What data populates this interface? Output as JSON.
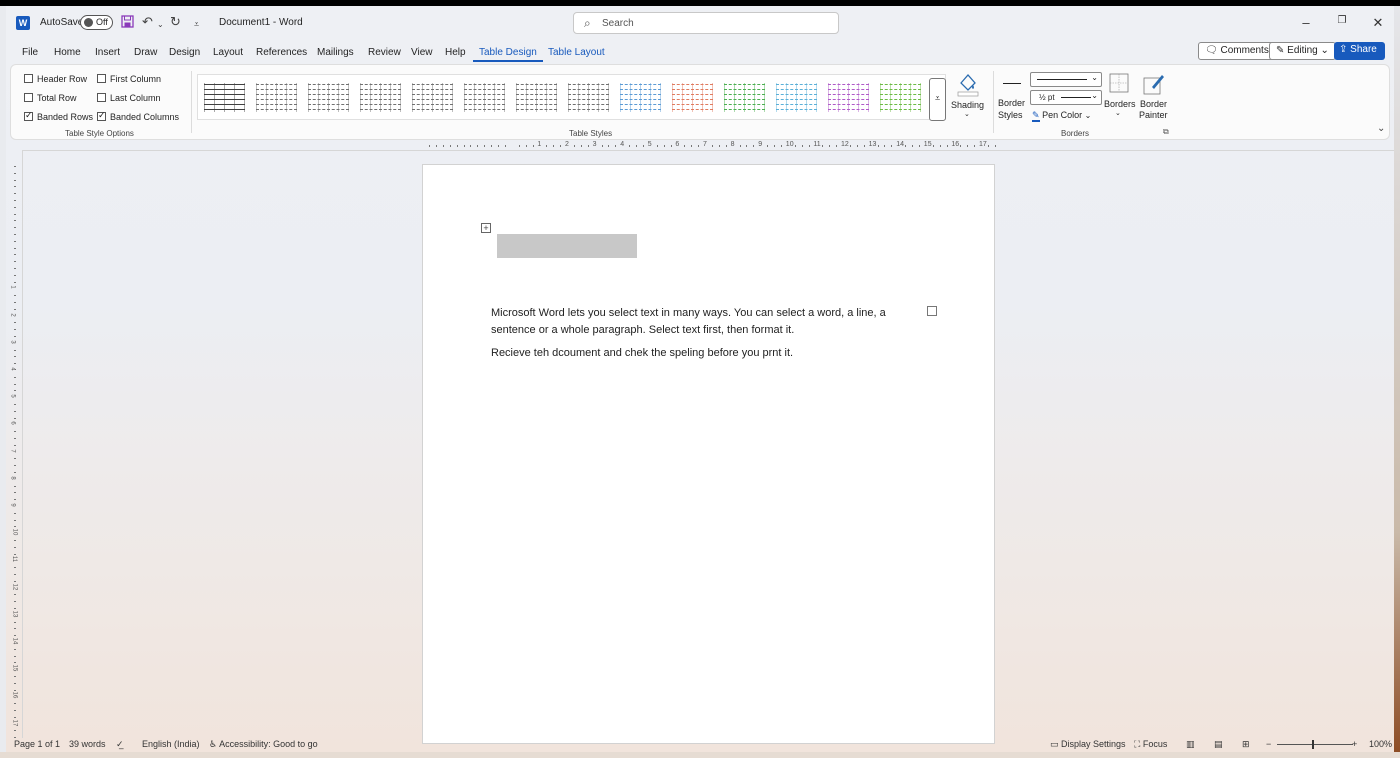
{
  "titlebar": {
    "autosave_label": "AutoSave",
    "autosave_state": "Off",
    "doc_title": "Document1  -  Word",
    "search_placeholder": "Search"
  },
  "tabs": [
    "File",
    "Home",
    "Insert",
    "Draw",
    "Design",
    "Layout",
    "References",
    "Mailings",
    "Review",
    "View",
    "Help",
    "Table Design",
    "Table Layout"
  ],
  "active_tab": "Table Design",
  "top_buttons": {
    "comments": "Comments",
    "editing": "Editing",
    "share": "Share"
  },
  "ribbon": {
    "style_options": {
      "header_row": "Header Row",
      "first_column": "First Column",
      "total_row": "Total Row",
      "last_column": "Last Column",
      "banded_rows": "Banded Rows",
      "banded_columns": "Banded Columns",
      "group_label": "Table Style Options"
    },
    "table_styles_label": "Table Styles",
    "swatch_colors": [
      "#404040",
      "#707070",
      "#707070",
      "#707070",
      "#707070",
      "#707070",
      "#707070",
      "#707070",
      "#5b9bd5",
      "#e07b5f",
      "#4caf50",
      "#5bb0d8",
      "#b05bc8",
      "#6dbb45"
    ],
    "shading": "Shading",
    "border_styles_1": "Border",
    "border_styles_2": "Styles",
    "pen_weight": "½ pt",
    "pen_color": "Pen Color",
    "borders": "Borders",
    "border_painter_1": "Border",
    "border_painter_2": "Painter",
    "borders_group_label": "Borders"
  },
  "document": {
    "paragraph1": "Microsoft Word lets you select text in many ways. You can select a word, a line, a sentence or a whole paragraph. Select text first, then format it.",
    "paragraph2": "Recieve teh dcoument and chek the speling before you prnt it."
  },
  "status": {
    "page": "Page 1 of 1",
    "words": "39 words",
    "language": "English (India)",
    "accessibility": "Accessibility: Good to go",
    "display_settings": "Display Settings",
    "focus": "Focus",
    "zoom": "100%"
  }
}
